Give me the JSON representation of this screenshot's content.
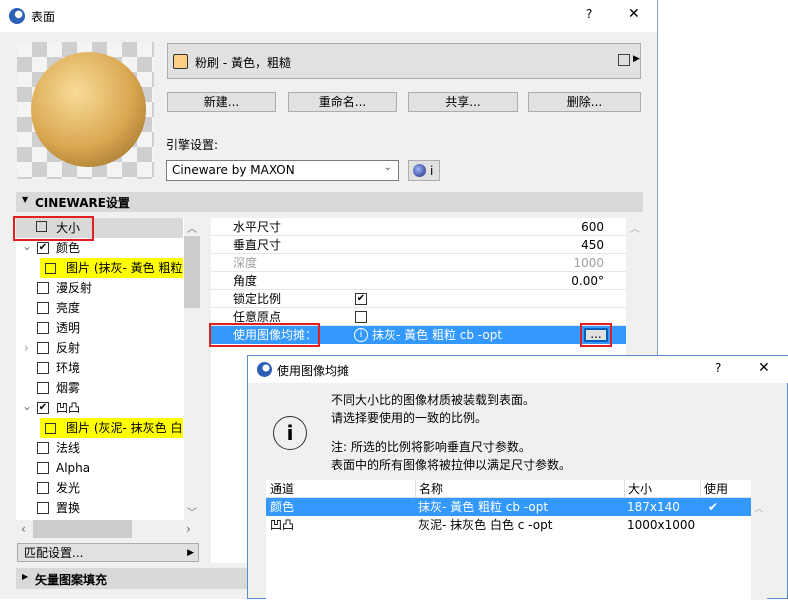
{
  "window": {
    "title": "表面",
    "help": "?",
    "close": "✕"
  },
  "material": {
    "name": "粉刷 - 黃色，粗糙",
    "swatch_color": "#fdd084"
  },
  "buttons": {
    "new": "新建...",
    "rename": "重命名...",
    "share": "共享...",
    "delete": "删除..."
  },
  "engine": {
    "label": "引擎设置:",
    "value": "Cineware by MAXON",
    "info": "i"
  },
  "cineware_header": "CINEWARE设置",
  "tree": [
    {
      "label": "大小",
      "type": "size"
    },
    {
      "label": "颜色",
      "checked": true,
      "expanded": true
    },
    {
      "label": "图片 (抹灰- 黃色 粗粒",
      "type": "image"
    },
    {
      "label": "漫反射",
      "checked": false
    },
    {
      "label": "亮度",
      "checked": false
    },
    {
      "label": "透明",
      "checked": false
    },
    {
      "label": "反射",
      "checked": false,
      "collapsed": true
    },
    {
      "label": "环境",
      "checked": false
    },
    {
      "label": "烟雾",
      "checked": false
    },
    {
      "label": "凹凸",
      "checked": true,
      "expanded": true
    },
    {
      "label": "图片 (灰泥- 抹灰色 白",
      "type": "image"
    },
    {
      "label": "法线",
      "checked": false
    },
    {
      "label": "Alpha",
      "checked": false
    },
    {
      "label": "发光",
      "checked": false
    },
    {
      "label": "置换",
      "checked": false
    }
  ],
  "match_settings": "匹配设置...",
  "vector_fill": "矢量图案填充",
  "props": [
    {
      "label": "水平尺寸",
      "value": "600"
    },
    {
      "label": "垂直尺寸",
      "value": "450"
    },
    {
      "label": "深度",
      "value": "1000",
      "disabled": true
    },
    {
      "label": "角度",
      "value": "0.00°"
    },
    {
      "label": "锁定比例",
      "checkbox": true,
      "checked": true
    },
    {
      "label": "任意原点",
      "checkbox": true,
      "checked": false
    }
  ],
  "use_image_row": {
    "label": "使用图像均摊：",
    "value": "抹灰- 黃色 粗粒 cb -opt",
    "button": "..."
  },
  "dialog": {
    "title": "使用图像均摊",
    "help": "?",
    "close": "✕",
    "msg1": "不同大小比的图像材质被装载到表面。",
    "msg2": "请选择要使用的一致的比例。",
    "note1": "注: 所选的比例将影响垂直尺寸参数。",
    "note2": "表面中的所有图像将被拉伸以满足尺寸参数。",
    "columns": [
      "通道",
      "名称",
      "大小",
      "使用"
    ],
    "rows": [
      {
        "channel": "颜色",
        "name": "抹灰- 黃色 粗粒 cb -opt",
        "size": "187x140",
        "use": "✔"
      },
      {
        "channel": "凹凸",
        "name": "灰泥- 抹灰色 白色 c -opt",
        "size": "1000x1000",
        "use": ""
      }
    ]
  }
}
